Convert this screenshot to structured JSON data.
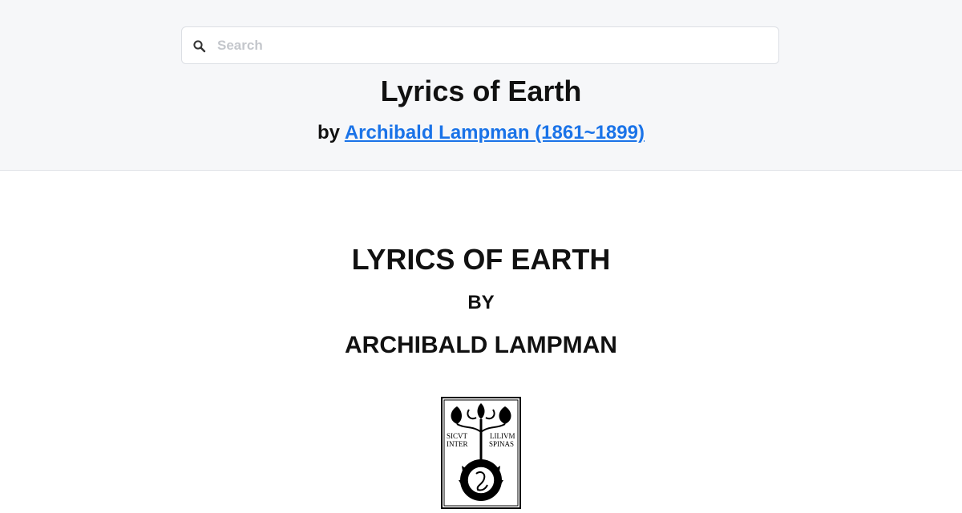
{
  "search": {
    "placeholder": "Search",
    "value": ""
  },
  "header": {
    "title": "Lyrics of Earth",
    "by_prefix": "by",
    "author_link": "Archibald Lampman (1861~1899)"
  },
  "page": {
    "cover_title": "LYRICS OF EARTH",
    "cover_by": "BY",
    "cover_author": "ARCHIBALD LAMPMAN"
  },
  "emblem": {
    "motto_left_1": "SICVT",
    "motto_left_2": "INTER",
    "motto_right_1": "LILIVM",
    "motto_right_2": "SPINAS"
  },
  "icons": {
    "search": "search-icon"
  }
}
